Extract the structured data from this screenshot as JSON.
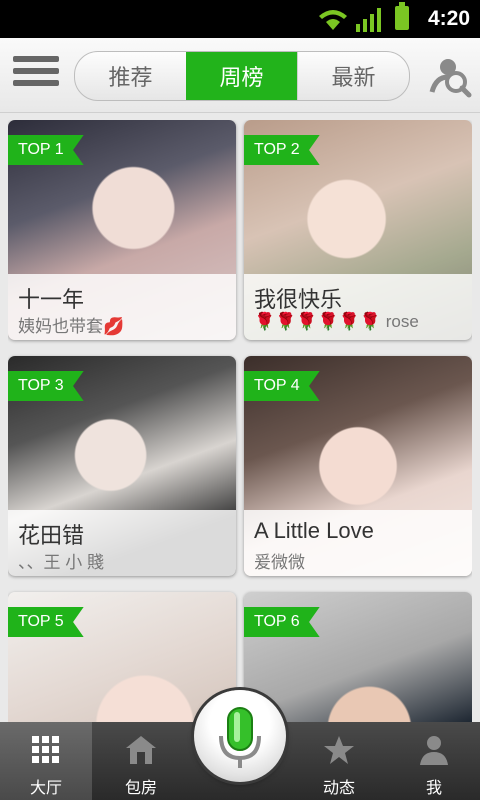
{
  "status_bar": {
    "time": "4:20"
  },
  "header": {
    "tabs": [
      "推荐",
      "周榜",
      "最新"
    ],
    "active_tab": "周榜"
  },
  "cards": [
    {
      "rank": "TOP 1",
      "name": "十一年",
      "sub": "姨妈也带套💋"
    },
    {
      "rank": "TOP 2",
      "name": "我很快乐",
      "sub": "🌹🌹🌹🌹🌹🌹 rose"
    },
    {
      "rank": "TOP 3",
      "name": "花田错",
      "sub": "、、王 小 賤"
    },
    {
      "rank": "TOP 4",
      "name": "A Little Love",
      "sub": "爰微微"
    },
    {
      "rank": "TOP 5",
      "name": "",
      "sub": ""
    },
    {
      "rank": "TOP 6",
      "name": "",
      "sub": ""
    }
  ],
  "bottom_nav": {
    "items": [
      {
        "label": "大厅",
        "icon": "grid-icon"
      },
      {
        "label": "包房",
        "icon": "house-icon"
      },
      {
        "label": "动态",
        "icon": "star-icon"
      },
      {
        "label": "我",
        "icon": "person-icon"
      }
    ],
    "center": {
      "icon": "microphone-icon"
    }
  },
  "colors": {
    "accent": "#22b31b",
    "nav_bg": "#3a3a3a"
  }
}
